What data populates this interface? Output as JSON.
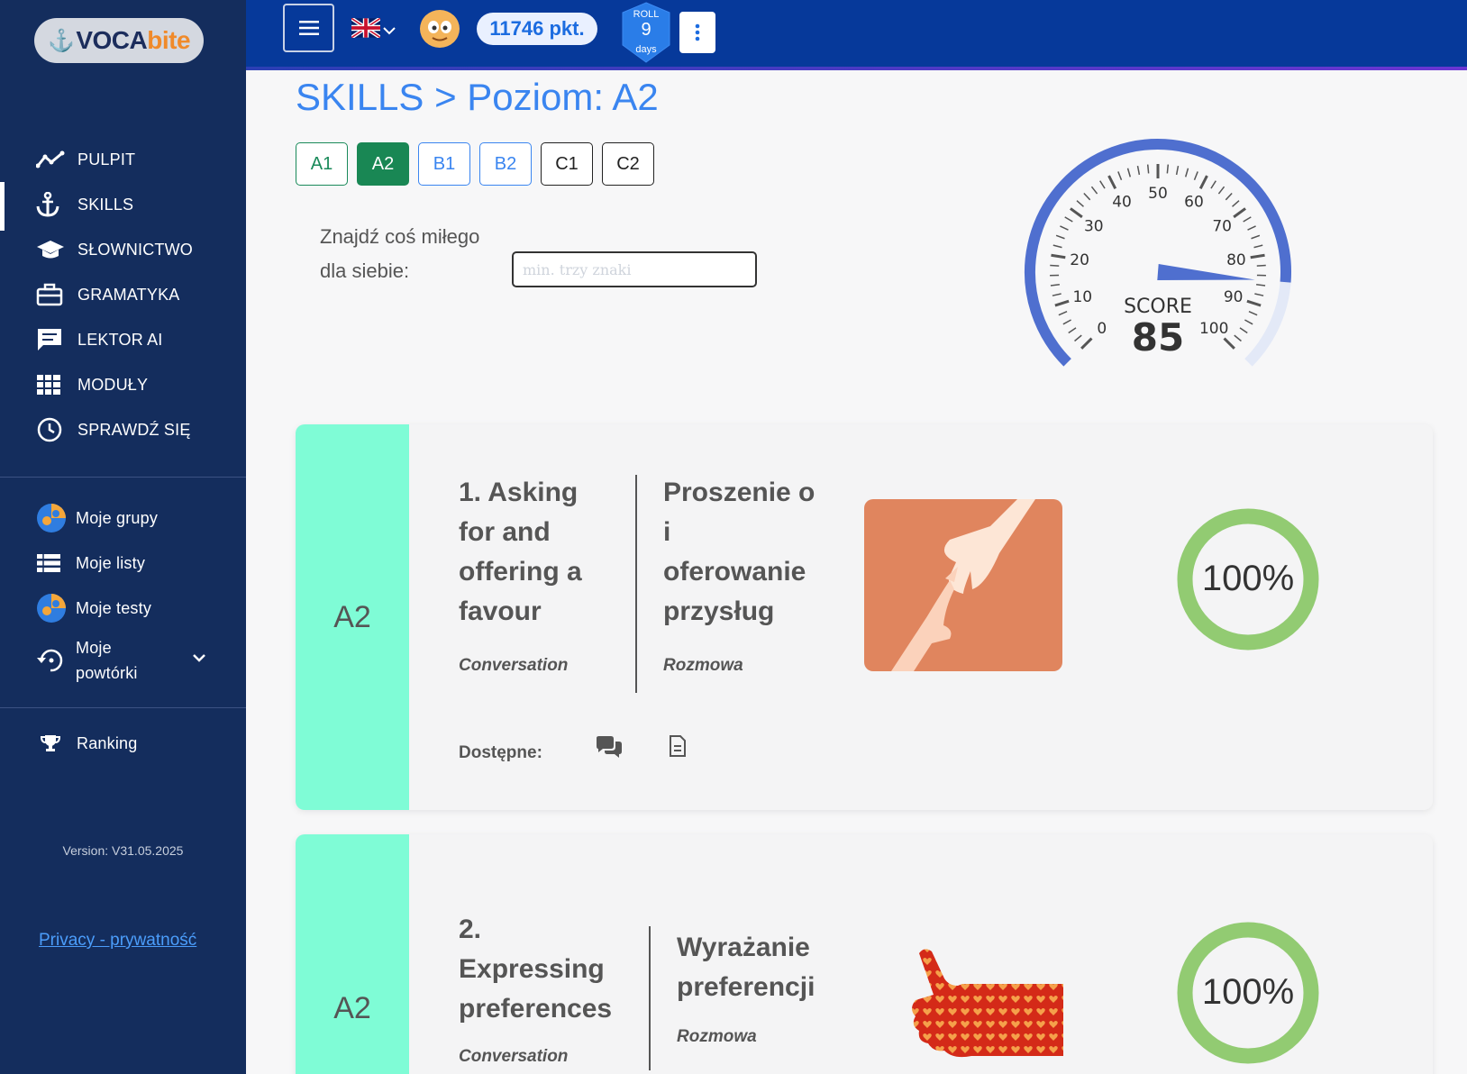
{
  "app": {
    "logo_part1": "VOCA",
    "logo_part2": "bite"
  },
  "sidebar": {
    "items": [
      {
        "label": "PULPIT",
        "icon": "chart-line-icon"
      },
      {
        "label": "SKILLS",
        "icon": "anchor-icon",
        "active": true
      },
      {
        "label": "SŁOWNICTWO",
        "icon": "graduation-cap-icon"
      },
      {
        "label": "GRAMATYKA",
        "icon": "briefcase-icon"
      },
      {
        "label": "LEKTOR AI",
        "icon": "message-icon"
      },
      {
        "label": "MODUŁY",
        "icon": "grid-icon"
      },
      {
        "label": "SPRAWDŹ SIĘ",
        "icon": "clock-icon"
      }
    ],
    "items2": [
      {
        "label": "Moje grupy",
        "icon": "groups-icon"
      },
      {
        "label": "Moje listy",
        "icon": "list-icon"
      },
      {
        "label": "Moje testy",
        "icon": "tests-icon"
      },
      {
        "label_line1": "Moje",
        "label_line2": "powtórki",
        "icon": "repeat-icon"
      }
    ],
    "ranking": "Ranking",
    "version": "Version: V31.05.2025",
    "privacy": "Privacy - prywatność"
  },
  "topbar": {
    "points": "11746 pkt.",
    "roll_top": "ROLL",
    "roll_num": "9",
    "roll_bottom": "days",
    "menu_icon": "hamburger-icon",
    "flag": "uk-flag-icon"
  },
  "main": {
    "title": "SKILLS > Poziom: A2",
    "levels": [
      "A1",
      "A2",
      "B1",
      "B2",
      "C1",
      "C2"
    ],
    "active_level": "A2",
    "find_label": "Znajdź coś miłego dla siebie:",
    "search_placeholder": "min. trzy znaki",
    "gauge": {
      "label": "SCORE",
      "value": 85,
      "ticks": [
        "0",
        "10",
        "20",
        "30",
        "40",
        "50",
        "60",
        "70",
        "80",
        "90",
        "100"
      ]
    }
  },
  "cards": [
    {
      "level": "A2",
      "en_lines": [
        "1. Asking",
        "for and",
        "offering a",
        "favour"
      ],
      "en_cat": "Conversation",
      "pl_lines": [
        "Proszenie o",
        "i",
        "oferowanie",
        "przysług"
      ],
      "pl_cat": "Rozmowa",
      "progress": "100%",
      "progress_value": 100,
      "available_label": "Dostępne:",
      "image": "helping-hands-image"
    },
    {
      "level": "A2",
      "en_lines": [
        "2.",
        "Expressing",
        "preferences"
      ],
      "en_cat": "Conversation",
      "pl_lines": [
        "Wyrażanie",
        "preferencji"
      ],
      "pl_cat": "Rozmowa",
      "progress": "100%",
      "progress_value": 100,
      "image": "thumbs-up-image"
    }
  ],
  "colors": {
    "sidebar": "#142d5d",
    "topbar": "#06399a",
    "accent": "#3a85f0",
    "stripe": "#7ffcd6",
    "ring": "#92cb72",
    "active_level": "#198754"
  }
}
